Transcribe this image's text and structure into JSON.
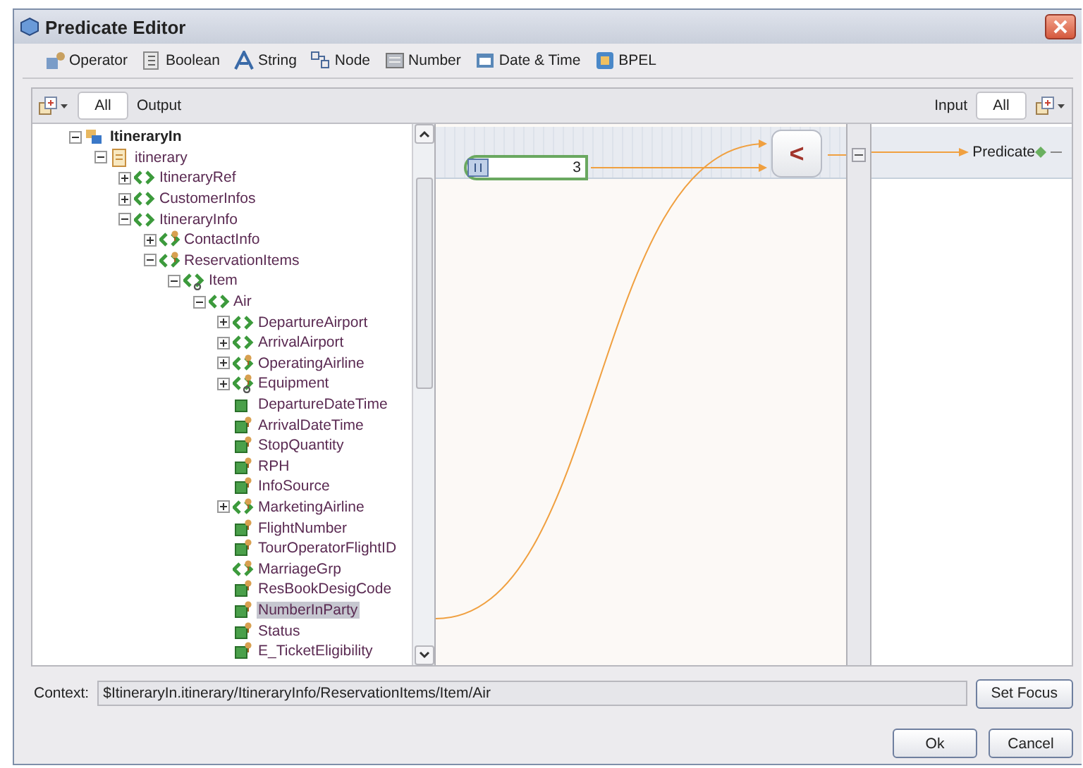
{
  "window": {
    "title": "Predicate Editor"
  },
  "toolbar": [
    "Operator",
    "Boolean",
    "String",
    "Node",
    "Number",
    "Date & Time",
    "BPEL"
  ],
  "left_header": {
    "tab": {
      "label": "All",
      "selected": true
    },
    "title": "Output"
  },
  "right_header": {
    "title": "Input",
    "tab": {
      "label": "All",
      "selected": true
    }
  },
  "tree": [
    {
      "label": "ItineraryIn",
      "kind": "part",
      "required": false,
      "repeating": false,
      "selected": false,
      "expanded": true,
      "children": [
        {
          "label": "itinerary",
          "kind": "document",
          "required": false,
          "repeating": false,
          "selected": false,
          "expanded": true,
          "children": [
            {
              "label": "ItineraryRef",
              "kind": "element",
              "required": false,
              "repeating": false,
              "selected": false,
              "expanded": false
            },
            {
              "label": "CustomerInfos",
              "kind": "element",
              "required": false,
              "repeating": false,
              "selected": false,
              "expanded": false
            },
            {
              "label": "ItineraryInfo",
              "kind": "element",
              "required": false,
              "repeating": false,
              "selected": false,
              "expanded": true,
              "children": [
                {
                  "label": "ContactInfo",
                  "kind": "element",
                  "required": true,
                  "repeating": false,
                  "selected": false,
                  "expanded": false
                },
                {
                  "label": "ReservationItems",
                  "kind": "element",
                  "required": true,
                  "repeating": false,
                  "selected": false,
                  "expanded": true,
                  "children": [
                    {
                      "label": "Item",
                      "kind": "element",
                      "required": false,
                      "repeating": true,
                      "selected": false,
                      "expanded": true,
                      "children": [
                        {
                          "label": "Air",
                          "kind": "element",
                          "required": false,
                          "repeating": false,
                          "selected": false,
                          "expanded": true,
                          "children": [
                            {
                              "label": "DepartureAirport",
                              "kind": "element",
                              "required": false,
                              "repeating": false,
                              "selected": false,
                              "expanded": false
                            },
                            {
                              "label": "ArrivalAirport",
                              "kind": "element",
                              "required": false,
                              "repeating": false,
                              "selected": false,
                              "expanded": false
                            },
                            {
                              "label": "OperatingAirline",
                              "kind": "element",
                              "required": true,
                              "repeating": false,
                              "selected": false,
                              "expanded": false
                            },
                            {
                              "label": "Equipment",
                              "kind": "element",
                              "required": true,
                              "repeating": true,
                              "selected": false,
                              "expanded": false
                            },
                            {
                              "label": "DepartureDateTime",
                              "kind": "attribute",
                              "required": false,
                              "repeating": false,
                              "selected": false
                            },
                            {
                              "label": "ArrivalDateTime",
                              "kind": "attribute",
                              "required": true,
                              "repeating": false,
                              "selected": false
                            },
                            {
                              "label": "StopQuantity",
                              "kind": "attribute",
                              "required": true,
                              "repeating": false,
                              "selected": false
                            },
                            {
                              "label": "RPH",
                              "kind": "attribute",
                              "required": true,
                              "repeating": false,
                              "selected": false
                            },
                            {
                              "label": "InfoSource",
                              "kind": "attribute",
                              "required": true,
                              "repeating": false,
                              "selected": false
                            },
                            {
                              "label": "MarketingAirline",
                              "kind": "element",
                              "required": true,
                              "repeating": false,
                              "selected": false,
                              "expanded": false
                            },
                            {
                              "label": "FlightNumber",
                              "kind": "attribute",
                              "required": true,
                              "repeating": false,
                              "selected": false
                            },
                            {
                              "label": "TourOperatorFlightID",
                              "kind": "attribute",
                              "required": true,
                              "repeating": false,
                              "selected": false
                            },
                            {
                              "label": "MarriageGrp",
                              "kind": "element",
                              "required": true,
                              "repeating": false,
                              "selected": false
                            },
                            {
                              "label": "ResBookDesigCode",
                              "kind": "attribute",
                              "required": true,
                              "repeating": false,
                              "selected": false
                            },
                            {
                              "label": "NumberInParty",
                              "kind": "attribute",
                              "required": true,
                              "repeating": false,
                              "selected": true
                            },
                            {
                              "label": "Status",
                              "kind": "attribute",
                              "required": true,
                              "repeating": false,
                              "selected": false
                            },
                            {
                              "label": "E_TicketEligibility",
                              "kind": "attribute",
                              "required": true,
                              "repeating": false,
                              "selected": false
                            }
                          ]
                        }
                      ]
                    }
                  ]
                }
              ]
            }
          ]
        }
      ]
    }
  ],
  "canvas": {
    "number_node": {
      "value": "3"
    },
    "operator_node": {
      "symbol": "<"
    }
  },
  "result": {
    "label": "Predicate"
  },
  "context": {
    "label": "Context:",
    "value": "$ItineraryIn.itinerary/ItineraryInfo/ReservationItems/Item/Air",
    "button": "Set Focus"
  },
  "buttons": [
    "Ok",
    "Cancel"
  ]
}
